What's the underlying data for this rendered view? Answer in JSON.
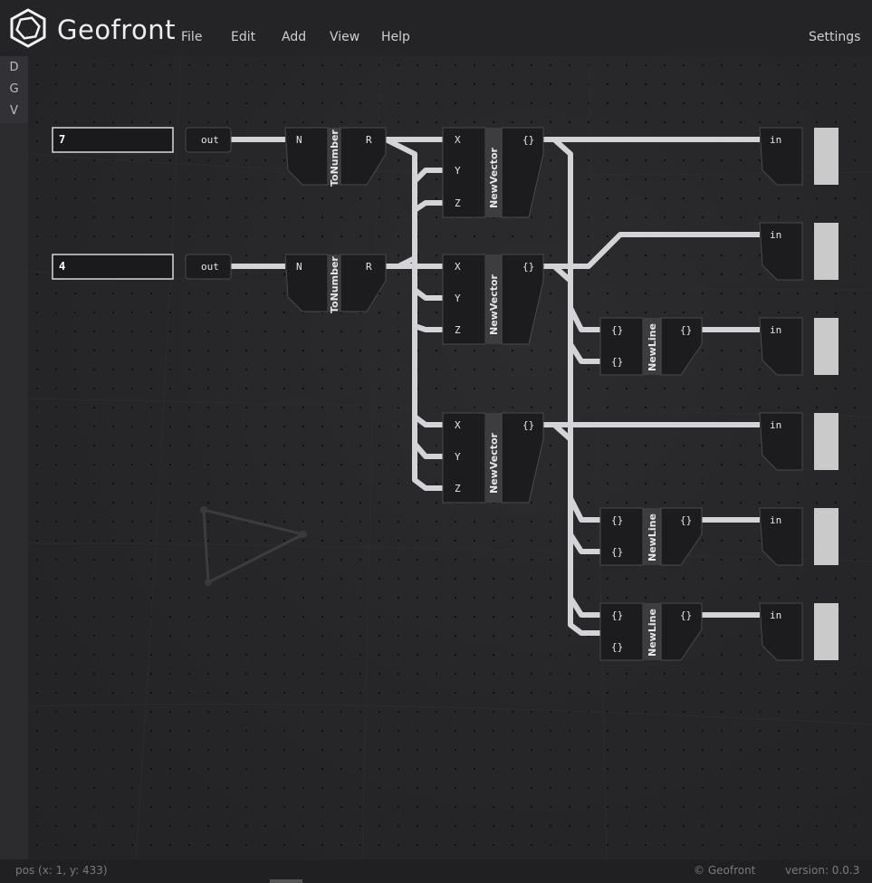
{
  "app": {
    "title": "Geofront",
    "menu": [
      "File",
      "Edit",
      "Add",
      "View",
      "Help"
    ],
    "settings_label": "Settings"
  },
  "sidebar": {
    "items": [
      "D",
      "G",
      "V"
    ]
  },
  "nodes": {
    "number_inputs": [
      {
        "value": "7",
        "port": "out"
      },
      {
        "value": "4",
        "port": "out"
      }
    ],
    "to_number": {
      "title": "ToNumber",
      "input": "N",
      "output": "R"
    },
    "new_vector": {
      "title": "NewVector",
      "inputs": [
        "X",
        "Y",
        "Z"
      ],
      "output": "{}"
    },
    "new_line": {
      "title": "NewLine",
      "inputs": [
        "{}",
        "{}"
      ],
      "output": "{}"
    },
    "viewer": {
      "input": "in"
    }
  },
  "footer": {
    "pos": "pos (x: 1, y: 433)",
    "brand": "© Geofront",
    "version": "version: 0.0.3"
  },
  "colors": {
    "background": "#232325",
    "node": "#1c1c1e",
    "wire": "#d4d4d8",
    "node_border": "#4a4a4e"
  }
}
